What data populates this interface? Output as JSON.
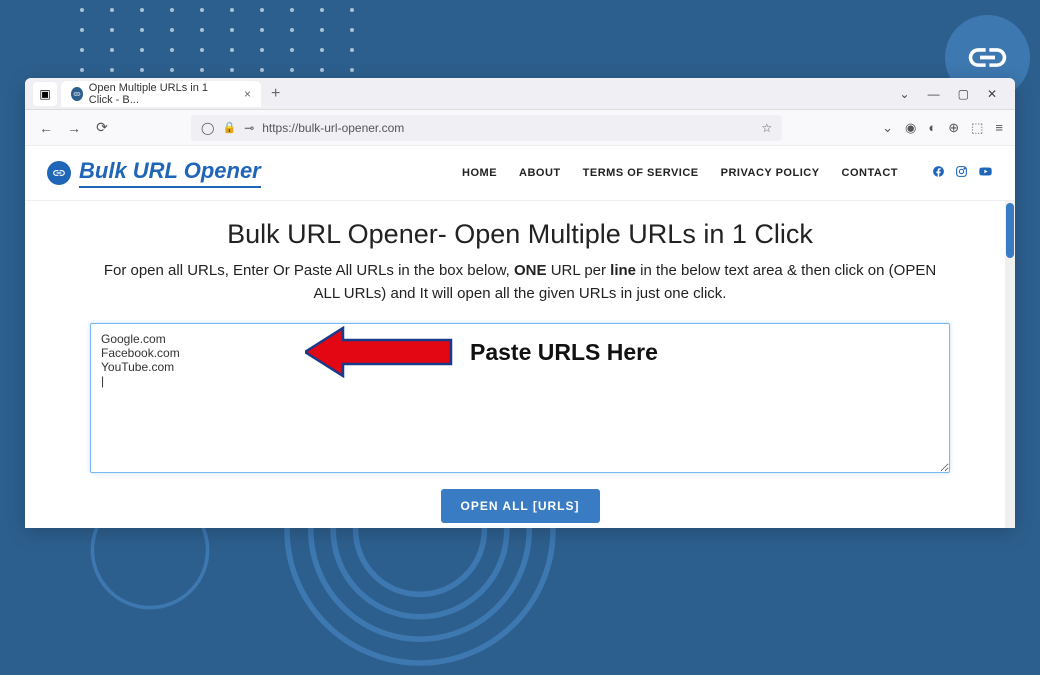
{
  "browser": {
    "tab_title": "Open Multiple URLs in 1 Click - B...",
    "url_display": "https://bulk-url-opener.com",
    "plus_label": "+",
    "close_label": "×"
  },
  "header": {
    "logo_text": "Bulk URL Opener",
    "nav": {
      "home": "HOME",
      "about": "ABOUT",
      "tos": "TERMS OF SERVICE",
      "privacy": "PRIVACY POLICY",
      "contact": "CONTACT"
    }
  },
  "content": {
    "title": "Bulk URL Opener- Open Multiple URLs in 1 Click",
    "subtitle_pre": "For open all URLs, Enter Or Paste All URLs in the box below, ",
    "subtitle_bold1": "ONE",
    "subtitle_mid": " URL per ",
    "subtitle_bold2": "line",
    "subtitle_post": " in the below text area & then click on (OPEN ALL URLs) and It will open all the given URLs in just one click.",
    "textarea_value": "Google.com\nFacebook.com\nYouTube.com\n|",
    "open_button": "OPEN ALL [URLS]",
    "annotation": "Paste URLS Here"
  }
}
